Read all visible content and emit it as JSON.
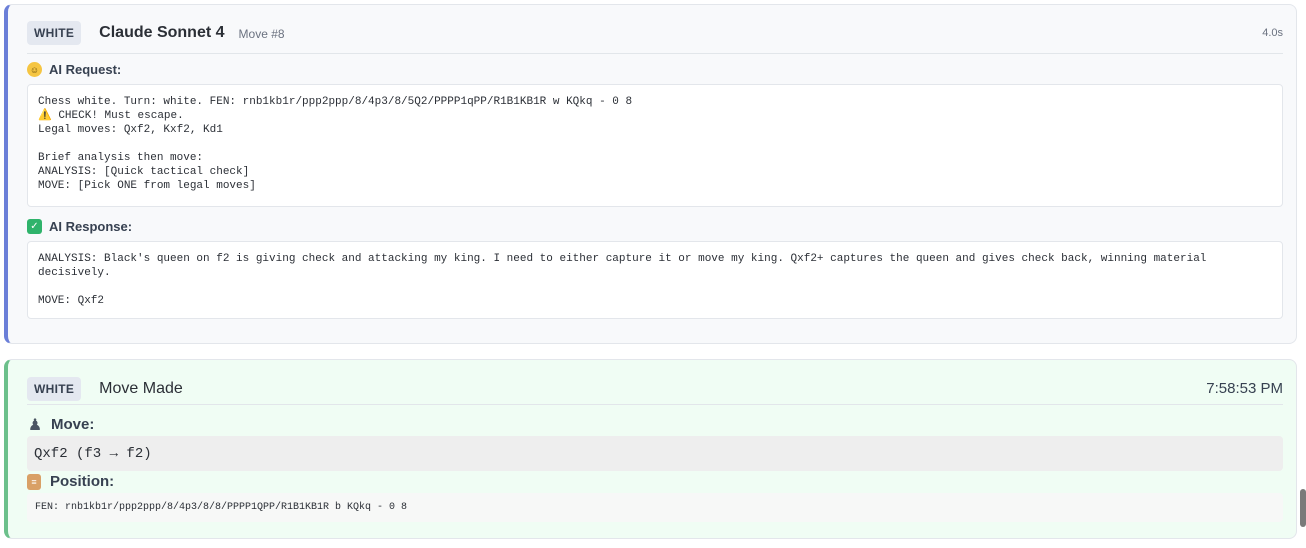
{
  "request_card": {
    "badge": "WHITE",
    "model": "Claude Sonnet 4",
    "move_number": "Move #8",
    "duration": "4.0s",
    "request_label": "AI Request:",
    "request_lines": {
      "l1": "Chess white. Turn: white. FEN: rnb1kb1r/ppp2ppp/8/4p3/8/5Q2/PPPP1qPP/R1B1KB1R w KQkq - 0 8",
      "l2": "CHECK! Must escape.",
      "l3": "Legal moves: Qxf2, Kxf2, Kd1",
      "l4": "Brief analysis then move:",
      "l5": "ANALYSIS: [Quick tactical check]",
      "l6": "MOVE: [Pick ONE from legal moves]"
    },
    "response_label": "AI Response:",
    "response_lines": {
      "l1": "ANALYSIS: Black's queen on f2 is giving check and attacking my king. I need to either capture it or move my king. Qxf2+ captures the queen and gives check back, winning material decisively.",
      "l2": "MOVE: Qxf2"
    }
  },
  "move_card": {
    "badge": "WHITE",
    "title": "Move Made",
    "time": "7:58:53 PM",
    "move_label": "Move:",
    "move_text": "Qxf2 (f3 → f2)",
    "position_label": "Position:",
    "fen_text": "FEN: rnb1kb1r/ppp2ppp/8/4p3/8/8/PPPP1QPP/R1B1KB1R b KQkq - 0 8"
  },
  "icons": {
    "request": "thinking-face-icon",
    "response": "check-mark-icon",
    "move": "pawn-icon",
    "position": "clipboard-icon",
    "warning": "warning-icon"
  },
  "colors": {
    "request_accent": "#6b7fd8",
    "move_accent": "#6cc08b",
    "check_green": "#2fb36b"
  }
}
